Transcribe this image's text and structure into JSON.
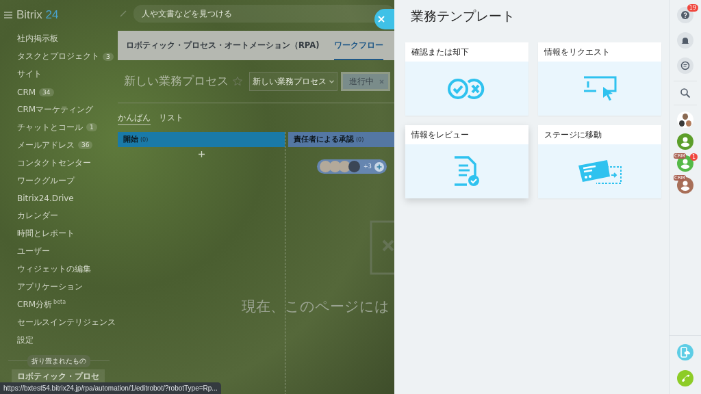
{
  "logo": {
    "name": "Bitrix",
    "number": "24"
  },
  "search": {
    "placeholder": "人や文書などを見つける"
  },
  "sidebar": {
    "items": [
      {
        "label": "社内掲示板"
      },
      {
        "label": "タスクとプロジェクト",
        "counter": "3"
      },
      {
        "label": "サイト"
      },
      {
        "label": "CRM",
        "counter": "34"
      },
      {
        "label": "CRMマーケティング"
      },
      {
        "label": "チャットとコール",
        "counter": "1"
      },
      {
        "label": "メールアドレス",
        "counter": "36"
      },
      {
        "label": "コンタクトセンター"
      },
      {
        "label": "ワークグループ"
      },
      {
        "label": "Bitrix24.Drive"
      },
      {
        "label": "カレンダー"
      },
      {
        "label": "時間とレポート"
      },
      {
        "label": "ユーザー"
      },
      {
        "label": "ウィジェットの編集"
      },
      {
        "label": "アプリケーション"
      },
      {
        "label": "CRM分析",
        "sup": "beta"
      },
      {
        "label": "セールスインテリジェンス"
      },
      {
        "label": "設定"
      }
    ],
    "collapsed_label": "折り畳まれたもの",
    "collapsed_items": [
      {
        "label": "ロボティック・プロセ"
      }
    ]
  },
  "header": {
    "title": "ロボティック・プロセス・オートメーション（RPA)",
    "tabs": [
      {
        "label": "ワークフロー",
        "selected": true
      }
    ]
  },
  "process": {
    "title": "新しい業務プロセス",
    "dropdown": "新しい業務プロセス",
    "filter_tag": "進行中"
  },
  "view_tabs": [
    {
      "label": "かんばん",
      "selected": true
    },
    {
      "label": "リスト",
      "selected": false
    }
  ],
  "columns": [
    {
      "title": "開始",
      "count": "(0)",
      "color": "#1a7aa8"
    },
    {
      "title": "責任者による承認",
      "count": "(0)",
      "color": "#5477a3"
    }
  ],
  "avatars_more": "+3",
  "empty_text": "現在、このページには",
  "status_url": "https://bxtest54.bitrix24.jp/rpa/automation/1/editrobot/?robotType=Rp...",
  "panel": {
    "title": "業務テンプレート",
    "templates": [
      {
        "label": "確認または却下",
        "kind": "approve"
      },
      {
        "label": "情報をリクエスト",
        "kind": "request"
      },
      {
        "label": "情報をレビュー",
        "kind": "review"
      },
      {
        "label": "ステージに移動",
        "kind": "move"
      }
    ]
  },
  "rightbar": {
    "help_badge": "19",
    "contacts": [
      {
        "kind": "group"
      },
      {
        "kind": "user",
        "color": "#5c9e2a"
      },
      {
        "kind": "user",
        "color": "#55b947",
        "tag": "CRM",
        "badge": "1"
      },
      {
        "kind": "user",
        "color": "#a86f58",
        "tag": "CRM"
      }
    ]
  }
}
